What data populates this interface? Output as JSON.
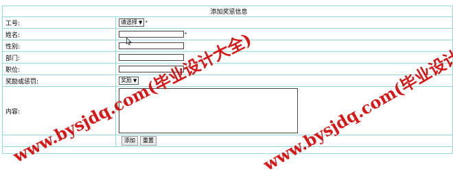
{
  "form": {
    "title": "添加奖惩信息",
    "fields": {
      "gonghao": {
        "label": "工号:",
        "select_value": "请选择",
        "required_mark": "*"
      },
      "name": {
        "label": "姓名:",
        "required_mark": "*"
      },
      "gender": {
        "label": "性别:"
      },
      "department": {
        "label": "部门:"
      },
      "position": {
        "label": "职位:"
      },
      "type": {
        "label": "奖励或惩罚:",
        "select_value": "奖励"
      },
      "content": {
        "label": "内容:"
      }
    },
    "buttons": {
      "add": "添加",
      "reset": "重置"
    }
  },
  "watermark": {
    "text": "www.bysjdq.com(毕业设计大全)",
    "color": "#d40000"
  }
}
